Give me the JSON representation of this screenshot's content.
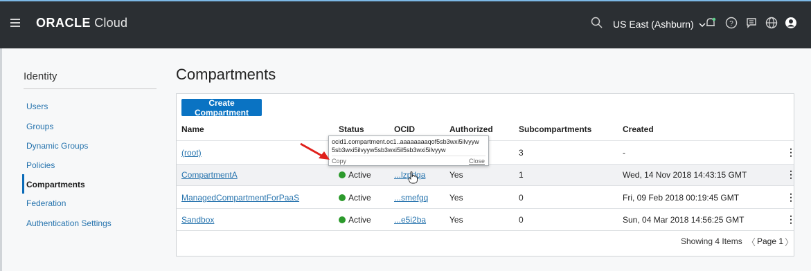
{
  "topbar": {
    "logo_brand": "ORACLE",
    "logo_product": "Cloud",
    "region": "US East (Ashburn)",
    "icons": [
      "search-icon",
      "bell-icon",
      "help-icon",
      "chat-icon",
      "globe-icon",
      "user-icon"
    ]
  },
  "sidebar": {
    "title": "Identity",
    "items": [
      {
        "label": "Users"
      },
      {
        "label": "Groups"
      },
      {
        "label": "Dynamic Groups"
      },
      {
        "label": "Policies"
      },
      {
        "label": "Compartments"
      },
      {
        "label": "Federation"
      },
      {
        "label": "Authentication Settings"
      }
    ],
    "active_index": 4
  },
  "main": {
    "title": "Compartments",
    "create_button": "Create Compartment",
    "columns": [
      "Name",
      "Status",
      "OCID",
      "Authorized",
      "Subcompartments",
      "Created"
    ],
    "rows": [
      {
        "name": "(root)",
        "status": "",
        "ocid": "",
        "authorized": "",
        "subcompartments": "3",
        "created": "-"
      },
      {
        "name": "CompartmentA",
        "status": "Active",
        "ocid": "...lzpdqa",
        "authorized": "Yes",
        "subcompartments": "1",
        "created": "Wed, 14 Nov 2018 14:43:15 GMT"
      },
      {
        "name": "ManagedCompartmentForPaaS",
        "status": "Active",
        "ocid": "...smefgq",
        "authorized": "Yes",
        "subcompartments": "0",
        "created": "Fri, 09 Feb 2018 00:19:45 GMT"
      },
      {
        "name": "Sandbox",
        "status": "Active",
        "ocid": "...e5i2ba",
        "authorized": "Yes",
        "subcompartments": "0",
        "created": "Sun, 04 Mar 2018 14:56:25 GMT"
      }
    ],
    "footer_text": "Showing 4 Items",
    "page_label": "Page 1"
  },
  "popover": {
    "line1": "ocid1.compartment.oc1..aaaaaaaaqof5sb3wxi5ilvyyw",
    "line2": "5sb3wxi5ilvyyw5sb3wxi5il5sb3wxi5ilvyyw",
    "copy_label": "Copy",
    "close_label": "Close"
  },
  "colors": {
    "topbar_bg": "#2b2f33",
    "primary_button": "#0a73c3",
    "link": "#2774ae",
    "active_status": "#2c9a2c",
    "annotation_arrow": "#e0201b"
  }
}
